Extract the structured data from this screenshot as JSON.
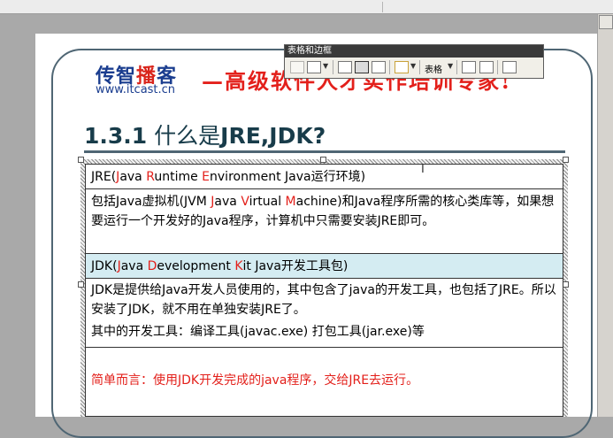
{
  "slide": {
    "logo": {
      "part1": "传智",
      "part2": "播",
      "part3": "客",
      "url": "www.itcast.cn"
    },
    "slogan": "—高级软件人才实作培训专家!",
    "heading": {
      "number": "1.3.1",
      "text_cn": "什么是",
      "text_en": "JRE,JDK?"
    }
  },
  "table": {
    "rows": [
      {
        "segments": [
          {
            "t": "JRE(",
            "c": "black"
          },
          {
            "t": "J",
            "c": "red"
          },
          {
            "t": "ava ",
            "c": "black"
          },
          {
            "t": "R",
            "c": "red"
          },
          {
            "t": "untime ",
            "c": "black"
          },
          {
            "t": "E",
            "c": "red"
          },
          {
            "t": "nvironment    Java运行环境)",
            "c": "black"
          }
        ]
      },
      {
        "segments": [
          {
            "t": "包括Java虚拟机(JVM ",
            "c": "black"
          },
          {
            "t": "J",
            "c": "red"
          },
          {
            "t": "ava ",
            "c": "black"
          },
          {
            "t": "V",
            "c": "red"
          },
          {
            "t": "irtual ",
            "c": "black"
          },
          {
            "t": "M",
            "c": "red"
          },
          {
            "t": "achine)和Java程序所需的核心类库等，如果想要运行一个开发好的Java程序，计算机中只需要安装JRE即可。",
            "c": "black"
          }
        ]
      },
      {
        "segments": [
          {
            "t": "JDK(",
            "c": "black"
          },
          {
            "t": "J",
            "c": "red"
          },
          {
            "t": "ava ",
            "c": "black"
          },
          {
            "t": "D",
            "c": "red"
          },
          {
            "t": "evelopment ",
            "c": "black"
          },
          {
            "t": "K",
            "c": "red"
          },
          {
            "t": "it    Java开发工具包)",
            "c": "black"
          }
        ]
      },
      {
        "segments": [
          {
            "t": "JDK是提供给Java开发人员使用的，其中包含了java的开发工具，也包括了JRE。所以安装了JDK，就不用在单独安装JRE了。",
            "c": "black"
          }
        ],
        "extra": "其中的开发工具：编译工具(javac.exe)  打包工具(jar.exe)等"
      },
      {
        "segments": [
          {
            "t": "简单而言：使用JDK开发完成的java程序，交给JRE去运行。",
            "c": "red"
          }
        ]
      }
    ]
  },
  "toolbar": {
    "title": "表格和边框",
    "table_menu": "表格"
  },
  "colors": {
    "brand_blue": "#1a3d8f",
    "brand_red": "#e3201b",
    "row_highlight": "#d4ecf2",
    "heading_color": "#183c4a"
  }
}
